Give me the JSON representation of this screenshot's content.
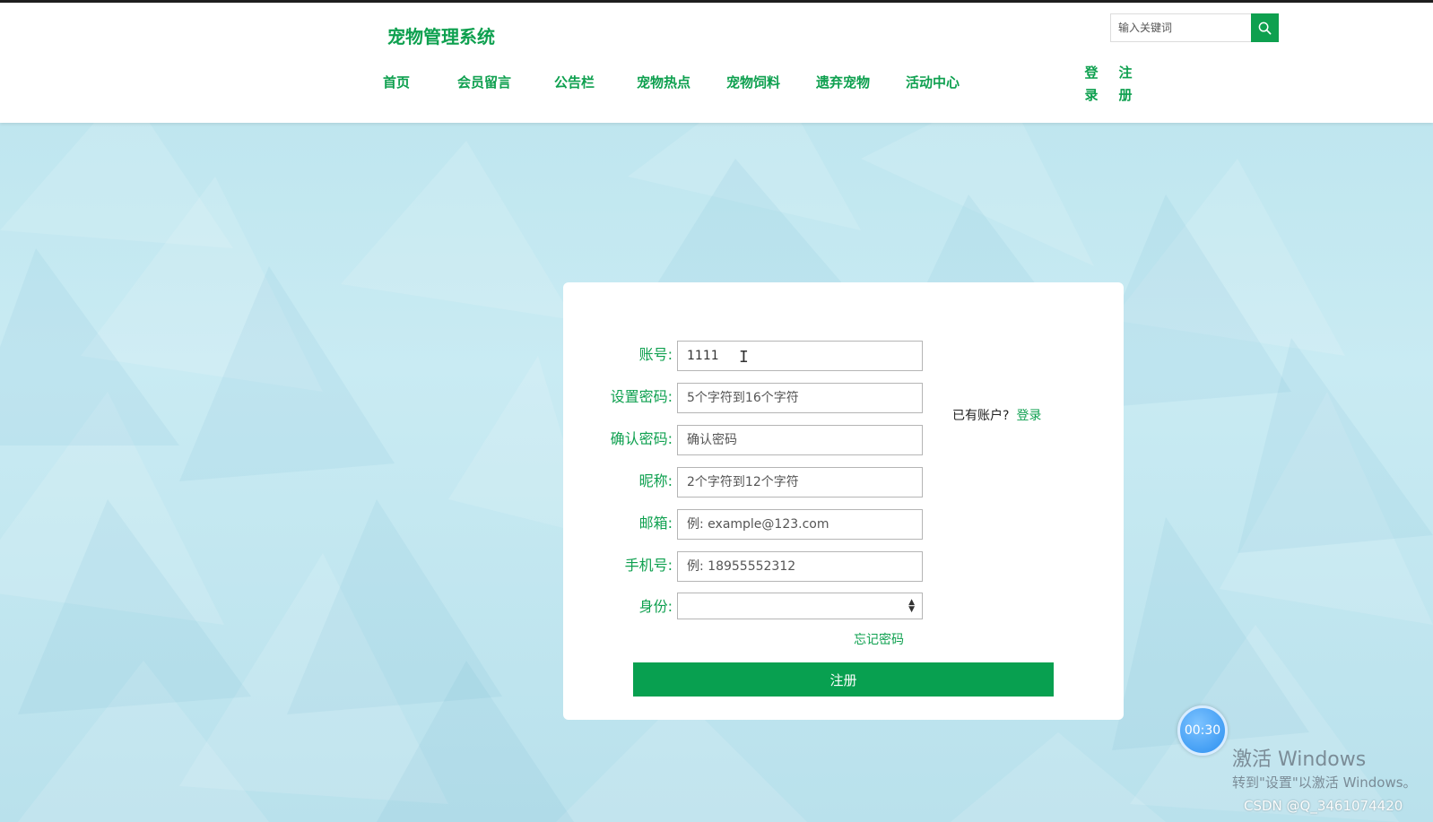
{
  "header": {
    "site_title": "宠物管理系统",
    "search_placeholder": "输入关键词",
    "search_icon": "search-icon",
    "nav": [
      "首页",
      "会员留言",
      "公告栏",
      "宠物热点",
      "宠物饲料",
      "遗弃宠物",
      "活动中心"
    ],
    "login_label": "登录",
    "register_label": "注册"
  },
  "form": {
    "fields": [
      {
        "label": "账号:",
        "value": "1111",
        "placeholder": ""
      },
      {
        "label": "设置密码:",
        "value": "",
        "placeholder": "5个字符到16个字符"
      },
      {
        "label": "确认密码:",
        "value": "",
        "placeholder": "确认密码"
      },
      {
        "label": "昵称:",
        "value": "",
        "placeholder": "2个字符到12个字符"
      },
      {
        "label": "邮箱:",
        "value": "",
        "placeholder": "例: example@123.com"
      },
      {
        "label": "手机号:",
        "value": "",
        "placeholder": "例: 18955552312"
      }
    ],
    "role_label": "身份:",
    "role_value": "",
    "have_account_text": "已有账户?",
    "login_link": "登录",
    "forgot_password": "忘记密码",
    "submit_label": "注册"
  },
  "overlay": {
    "timer": "00:30",
    "activate_title": "激活 Windows",
    "activate_sub": "转到\"设置\"以激活 Windows。",
    "csdn": "CSDN @Q_3461074420"
  },
  "colors": {
    "accent": "#0ea04f",
    "background": "#c6e9f2"
  }
}
